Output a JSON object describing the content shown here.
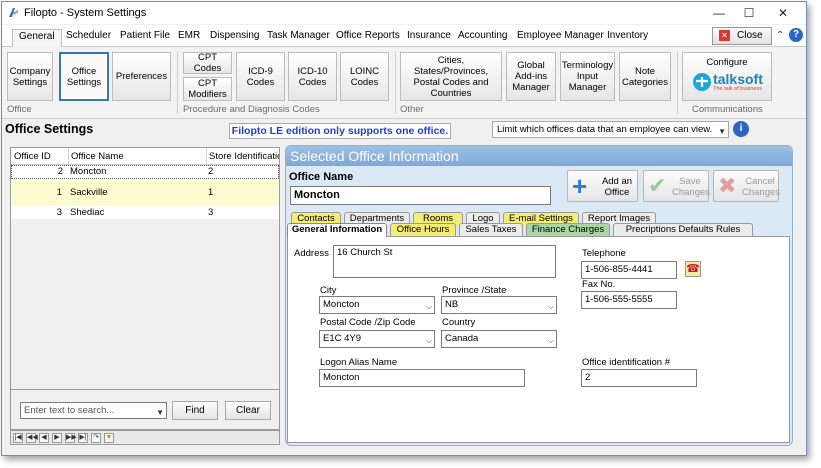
{
  "window": {
    "title": "Filopto - System Settings",
    "controls": [
      "—",
      "☐",
      "✕"
    ]
  },
  "menu_tabs": [
    "General",
    "Scheduler",
    "Patient File",
    "EMR",
    "Dispensing",
    "Task Manager",
    "Office Reports",
    "Insurance",
    "Accounting",
    "Employee Manager",
    "Inventory"
  ],
  "close_button": "Close",
  "ribbon": {
    "office_group": {
      "label": "Office",
      "buttons": [
        "Company Settings",
        "Office Settings",
        "Preferences"
      ]
    },
    "procedure_group": {
      "label": "Procedure and Diagnosis Codes",
      "buttons": [
        "CPT Codes",
        "CPT Modifiers",
        "ICD-9 Codes",
        "ICD-10 Codes",
        "LOINC Codes"
      ]
    },
    "other_group": {
      "label": "Other",
      "buttons": [
        "Cities, States/Provinces, Postal Codes and Countries",
        "Global Add-ins Manager",
        "Terminology Input Manager",
        "Note Categories"
      ]
    },
    "communications_group": {
      "label": "Communications",
      "configure_label": "Configure",
      "logo_text": "talksoft",
      "logo_tagline": "The talk of business"
    }
  },
  "office_settings_title": "Office Settings",
  "le_note": "Filopto LE edition only supports one office.",
  "limit_select": "Limit which offices data that an employee can view.",
  "grid": {
    "columns": [
      "Office ID",
      "Office Name",
      "Store Identification"
    ],
    "rows": [
      {
        "id": "2",
        "name": "Moncton",
        "store": "2"
      },
      {
        "id": "1",
        "name": "Sackville",
        "store": "1"
      },
      {
        "id": "3",
        "name": "Shediac",
        "store": "3"
      }
    ]
  },
  "search": {
    "placeholder": "Enter text to search...",
    "find": "Find",
    "clear": "Clear"
  },
  "nav_buttons": [
    "|◀",
    "◀◀",
    "◀",
    "▶",
    "▶▶",
    "▶|",
    "↷",
    "▼"
  ],
  "panel": {
    "title": "Selected Office Information",
    "office_name_label": "Office Name",
    "office_name_value": "Moncton",
    "add_office": "Add an Office",
    "save_changes": "Save Changes",
    "cancel_changes": "Cancel Changes"
  },
  "tabs_back": [
    "Contacts",
    "Departments",
    "Rooms",
    "Logo",
    "E-mail Settings",
    "Report Images"
  ],
  "tabs_front": [
    "General Information",
    "Office Hours",
    "Sales Taxes",
    "Finance Charges",
    "Precriptions Defaults Rules"
  ],
  "colors": {
    "yellow_tab": "#f5ec74",
    "green_tab": "#a9d6a2",
    "selected_row": "#fdfbd0",
    "accent": "#3c73b8"
  },
  "general_info": {
    "address_label": "Address",
    "address_value": "16 Church St",
    "city_label": "City",
    "city_value": "Moncton",
    "province_label": "Province /State",
    "province_value": "NB",
    "postal_label": "Postal Code /Zip Code",
    "postal_value": "E1C 4Y9",
    "country_label": "Country",
    "country_value": "Canada",
    "logon_label": "Logon Alias Name",
    "logon_value": "Moncton",
    "telephone_label": "Telephone",
    "telephone_value": "1-506-855-4441",
    "fax_label": "Fax No.",
    "fax_value": "1-506-555-5555",
    "office_id_label": "Office identification #",
    "office_id_value": "2"
  }
}
